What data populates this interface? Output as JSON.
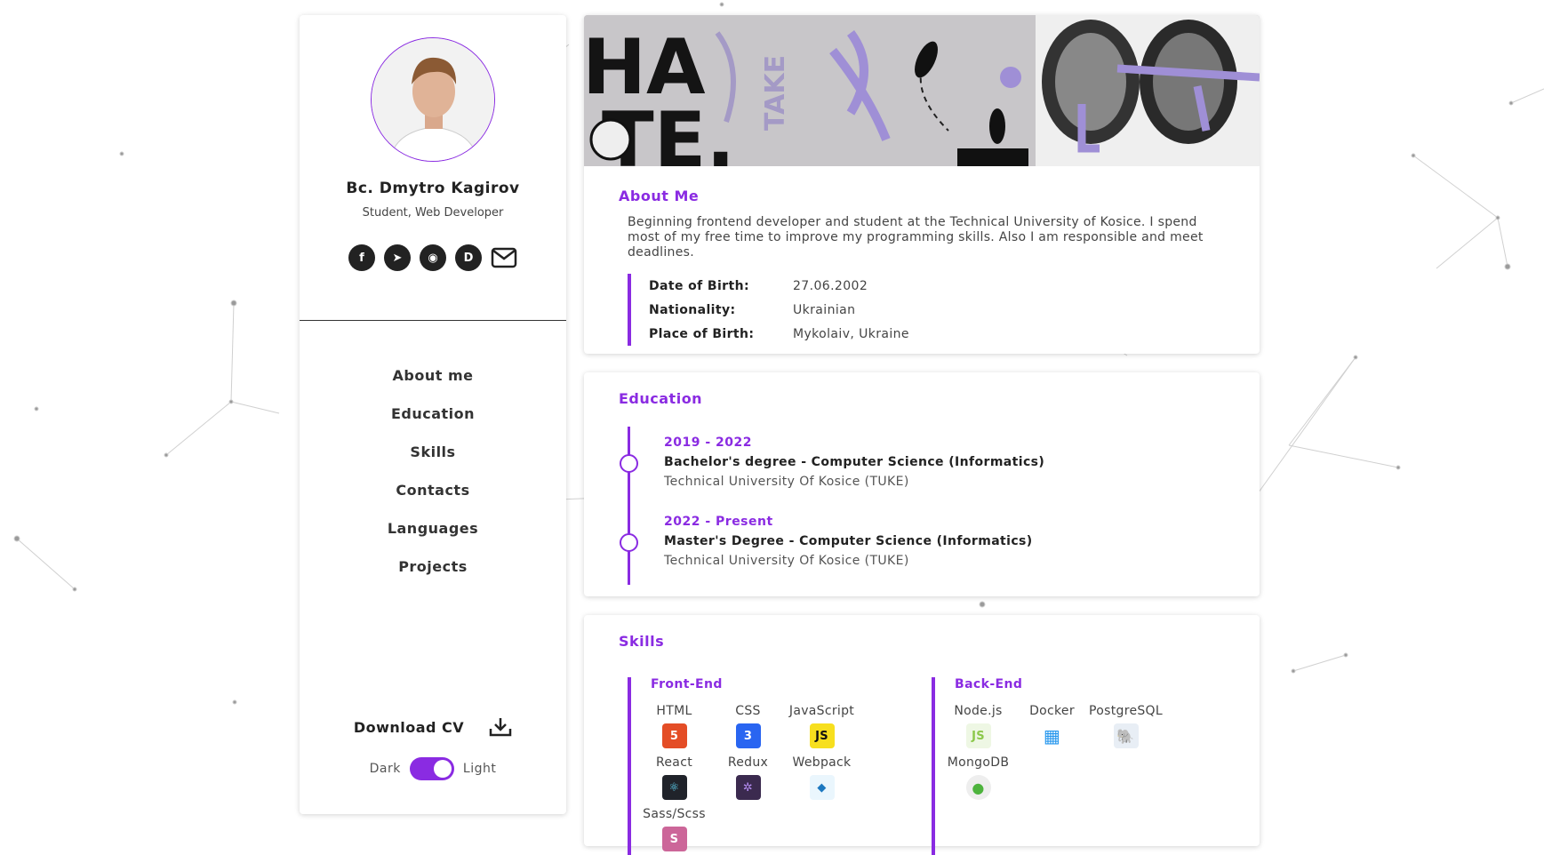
{
  "profile": {
    "name": "Bc. Dmytro Kagirov",
    "role": "Student, Web Developer",
    "socials": [
      {
        "name": "facebook-icon",
        "glyph": "f"
      },
      {
        "name": "telegram-icon",
        "glyph": "➤"
      },
      {
        "name": "github-icon",
        "glyph": "◉"
      },
      {
        "name": "discord-icon",
        "glyph": "D"
      },
      {
        "name": "mail-icon",
        "glyph": "✉"
      }
    ]
  },
  "nav": [
    "About me",
    "Education",
    "Skills",
    "Contacts",
    "Languages",
    "Projects"
  ],
  "download_cv": "Download CV",
  "theme": {
    "dark": "Dark",
    "light": "Light",
    "active": "Light"
  },
  "colors": {
    "accent": "#8a2be2"
  },
  "about": {
    "title": "About Me",
    "text": "Beginning frontend developer and student at the Technical University of Kosice. I spend most of my free time to improve my programming skills. Also I am responsible and meet deadlines.",
    "rows": [
      {
        "label": "Date of Birth:",
        "value": "27.06.2002"
      },
      {
        "label": "Nationality:",
        "value": "Ukrainian"
      },
      {
        "label": "Place of Birth:",
        "value": "Mykolaiv, Ukraine"
      }
    ]
  },
  "education": {
    "title": "Education",
    "items": [
      {
        "period": "2019 - 2022",
        "degree": "Bachelor's degree - Computer Science (Informatics)",
        "school": "Technical University Of Kosice (TUKE)"
      },
      {
        "period": "2022 - Present",
        "degree": "Master's Degree - Computer Science (Informatics)",
        "school": "Technical University Of Kosice (TUKE)"
      }
    ]
  },
  "skills": {
    "title": "Skills",
    "frontend": {
      "title": "Front-End",
      "items": [
        {
          "name": "HTML",
          "icon": "html5-icon",
          "color": "#e44d26",
          "glyph": "5"
        },
        {
          "name": "CSS",
          "icon": "css3-icon",
          "color": "#2965f1",
          "glyph": "3"
        },
        {
          "name": "JavaScript",
          "icon": "javascript-icon",
          "color": "#f7df1e",
          "glyph": "JS"
        },
        {
          "name": "React",
          "icon": "react-icon",
          "color": "#20232a",
          "glyph": "⚛"
        },
        {
          "name": "Redux",
          "icon": "redux-icon",
          "color": "#3b2a4f",
          "glyph": "✲"
        },
        {
          "name": "Webpack",
          "icon": "webpack-icon",
          "color": "#8ed6fb",
          "glyph": "◆"
        },
        {
          "name": "Sass/Scss",
          "icon": "sass-icon",
          "color": "#cc6699",
          "glyph": "S"
        }
      ]
    },
    "backend": {
      "title": "Back-End",
      "items": [
        {
          "name": "Node.js",
          "icon": "nodejs-icon",
          "color": "#8cc84b",
          "glyph": "JS"
        },
        {
          "name": "Docker",
          "icon": "docker-icon",
          "color": "#2496ed",
          "glyph": "▦"
        },
        {
          "name": "PostgreSQL",
          "icon": "postgresql-icon",
          "color": "#336791",
          "glyph": "🐘"
        },
        {
          "name": "MongoDB",
          "icon": "mongodb-icon",
          "color": "#4db33d",
          "glyph": "●"
        }
      ]
    }
  }
}
